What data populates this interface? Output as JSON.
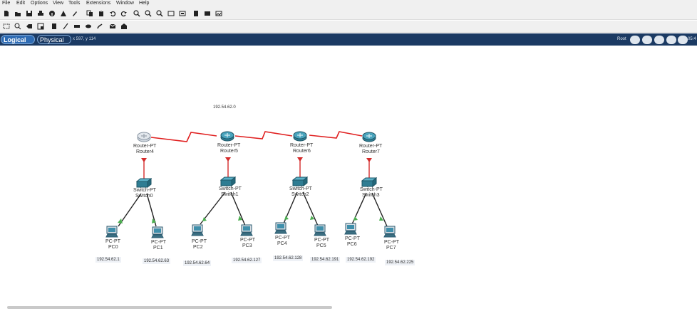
{
  "menu": [
    "File",
    "Edit",
    "Options",
    "View",
    "Tools",
    "Extensions",
    "Window",
    "Help"
  ],
  "toolbar_icons": [
    "new-icon",
    "open-icon",
    "save-icon",
    "print-icon",
    "info-icon",
    "network-wizard-icon",
    "pen-icon",
    "copy-icon",
    "paste-icon",
    "undo-icon",
    "redo-icon",
    "zoom-in-icon",
    "zoom-reset-icon",
    "zoom-out-icon",
    "drawing-palette-icon",
    "custom-device-icon",
    "list-icon",
    "pdu-icon",
    "screenshot-icon"
  ],
  "toolbar2_icons": [
    "select-icon",
    "inspect-icon",
    "delete-icon",
    "resize-icon",
    "note-icon",
    "line-icon",
    "rectangle-icon",
    "ellipse-icon",
    "freeform-icon",
    "add-simple-pdu-icon",
    "add-complex-pdu-icon"
  ],
  "tabs": {
    "logical": "Logical",
    "physical": "Physical"
  },
  "coords": "x 597, y 114",
  "root": "Root",
  "clock": "05:4",
  "network": {
    "label_top": "192.54.62.0",
    "routers": [
      {
        "type": "Router-PT",
        "name": "Router4"
      },
      {
        "type": "Router-PT",
        "name": "Router5"
      },
      {
        "type": "Router-PT",
        "name": "Router6"
      },
      {
        "type": "Router-PT",
        "name": "Router7"
      }
    ],
    "switches": [
      {
        "type": "Switch-PT",
        "name": "Switch0"
      },
      {
        "type": "Switch-PT",
        "name": "Switch1"
      },
      {
        "type": "Switch-PT",
        "name": "Switch2"
      },
      {
        "type": "Switch-PT",
        "name": "Switch3"
      }
    ],
    "pcs": [
      {
        "type": "PC-PT",
        "name": "PC0"
      },
      {
        "type": "PC-PT",
        "name": "PC1"
      },
      {
        "type": "PC-PT",
        "name": "PC2"
      },
      {
        "type": "PC-PT",
        "name": "PC3"
      },
      {
        "type": "PC-PT",
        "name": "PC4"
      },
      {
        "type": "PC-PT",
        "name": "PC5"
      },
      {
        "type": "PC-PT",
        "name": "PC6"
      },
      {
        "type": "PC-PT",
        "name": "PC7"
      }
    ],
    "ip_labels": [
      "192.54.62.1",
      "192.54.62.63",
      "192.54.62.64",
      "192.54.62.127",
      "192.54.62.128",
      "192.54.62.191",
      "192.54.62.192",
      "192.54.62.225"
    ]
  },
  "colors": {
    "accent": "#1b3a63",
    "link_serial": "#e02020",
    "link_red": "#d42a2a",
    "link_ok": "#222222",
    "port_up": "#4caf50"
  }
}
